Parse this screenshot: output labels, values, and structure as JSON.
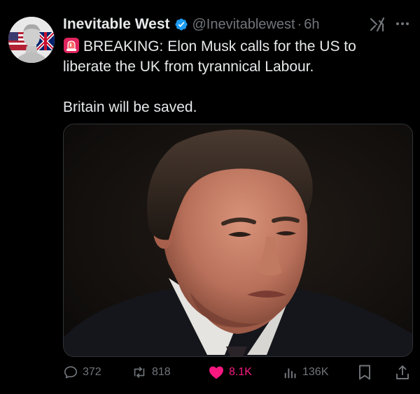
{
  "tweet": {
    "author": {
      "name": "Inevitable West",
      "handle": "@Inevitablewest",
      "separator": "·",
      "time": "6h"
    },
    "text": {
      "line1": "BREAKING: Elon Musk calls for the US to",
      "line2": "liberate the UK from tyrannical Labour.",
      "line3": "Britain will be saved."
    },
    "icons": {
      "verified": "verified-badge-icon",
      "siren": "police-light-emoji",
      "grok": "grok-icon",
      "more": "more-options-icon"
    },
    "actions": {
      "replies": "372",
      "reposts": "818",
      "likes": "8.1K",
      "views": "136K"
    },
    "colors": {
      "background": "#000000",
      "text": "#e7e9ea",
      "muted": "#71767b",
      "verified": "#1d9bf0",
      "like": "#f91880"
    }
  }
}
